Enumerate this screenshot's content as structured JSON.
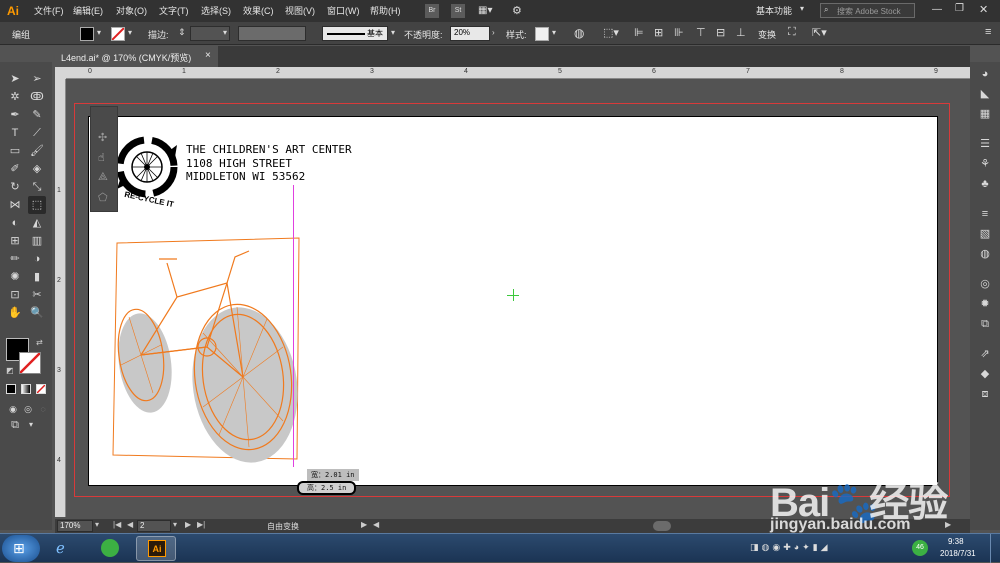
{
  "app": {
    "logo": "Ai"
  },
  "menu": {
    "items": [
      "文件(F)",
      "编辑(E)",
      "对象(O)",
      "文字(T)",
      "选择(S)",
      "效果(C)",
      "视图(V)",
      "窗口(W)",
      "帮助(H)"
    ],
    "bridge": "Br",
    "stock": "St",
    "workspace": "基本功能",
    "search_placeholder": "搜索 Adobe Stock"
  },
  "control": {
    "selection_label": "编组",
    "stroke_label": "描边:",
    "stroke_style": "基本",
    "opacity_label": "不透明度:",
    "opacity_value": "20%",
    "style_label": "样式:",
    "transform_label": "变换"
  },
  "document": {
    "tab_title": "L4end.ai* @ 170% (CMYK/预览)",
    "close": "×"
  },
  "ruler": {
    "h_ticks": [
      "0",
      "1",
      "2",
      "3",
      "4",
      "5",
      "6",
      "7",
      "8",
      "9"
    ],
    "v_ticks": [
      "1",
      "2",
      "3",
      "4"
    ]
  },
  "artwork": {
    "logo_caption": "RE-CYCLE IT",
    "address_lines": [
      "THE CHILDREN'S ART CENTER",
      "1108 HIGH STREET",
      "MIDDLETON WI 53562"
    ],
    "measure_width": "宽：2.01 in",
    "measure_height": "高：2.5 in"
  },
  "status": {
    "zoom": "170%",
    "artboard_number": "2",
    "tool_name": "自由变换"
  },
  "taskbar": {
    "ai_label": "Ai",
    "badge": "46",
    "time": "9:38",
    "date": "2018/7/31"
  },
  "watermark": {
    "brand": "Bai",
    "brand2": "经验",
    "url": "jingyan.baidu.com"
  },
  "colors": {
    "selection_orange": "#f07a1e",
    "bleed_red": "#d83a3a",
    "guide_magenta": "#e040e0",
    "center_mark_green": "#3cc83c"
  }
}
